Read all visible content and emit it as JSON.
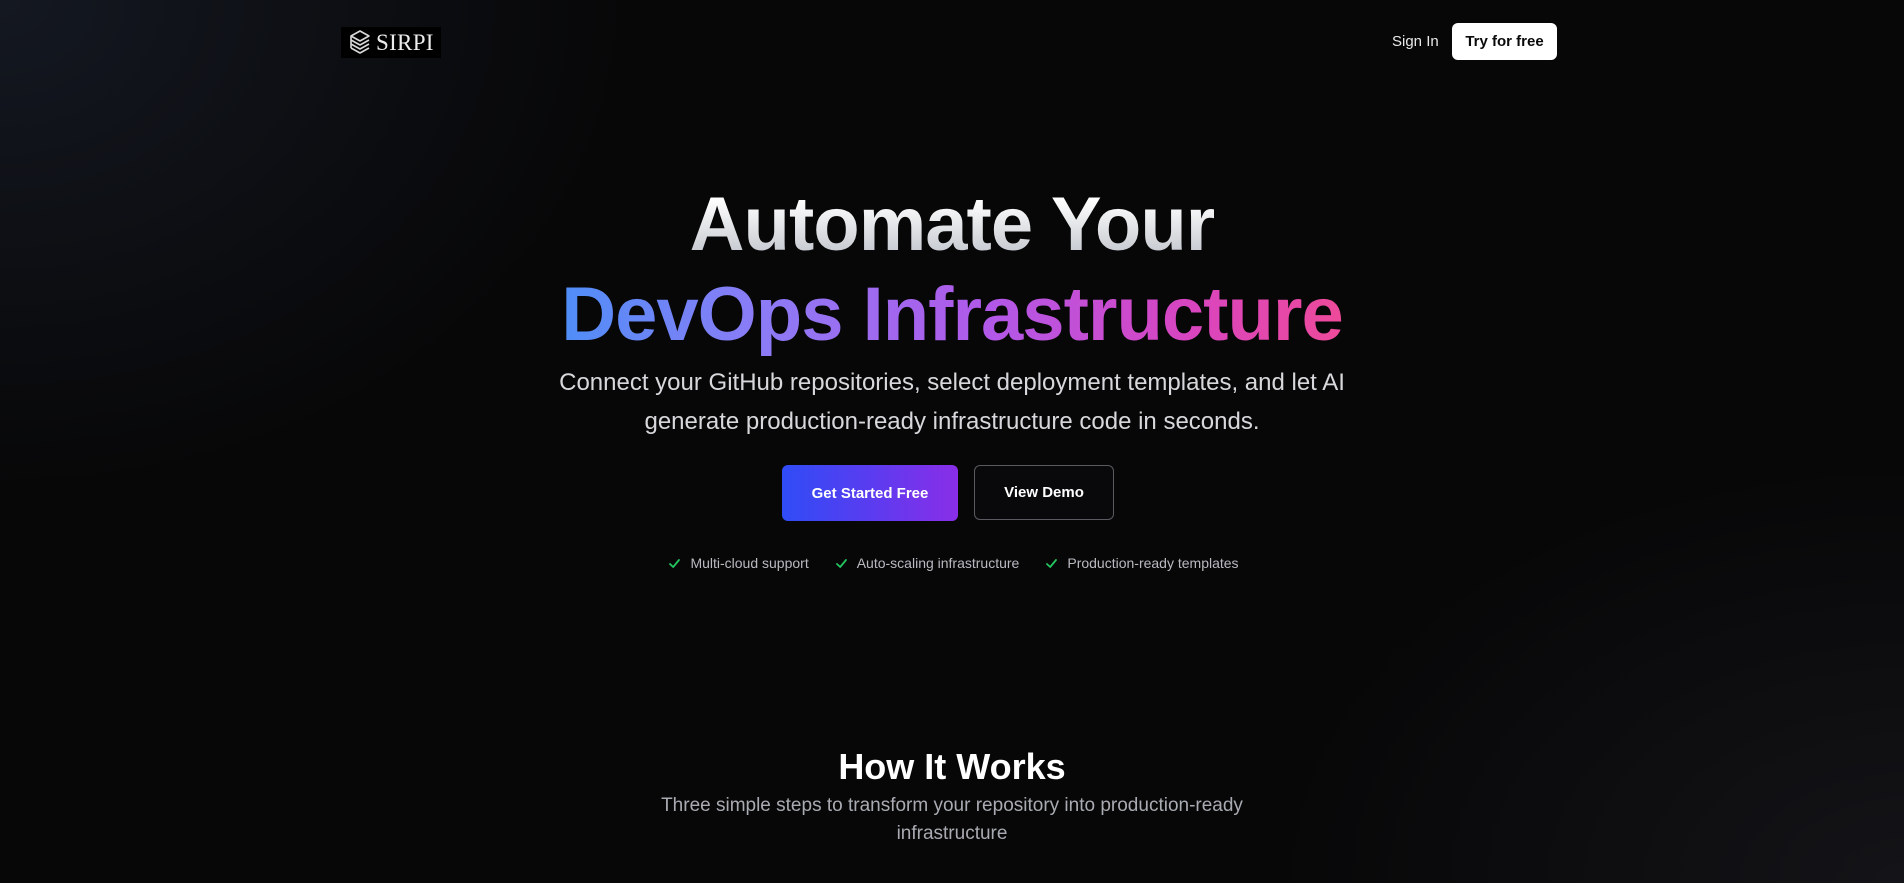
{
  "nav": {
    "logo_text": "SIRPI",
    "sign_in_label": "Sign In",
    "try_label": "Try for free"
  },
  "hero": {
    "title_line1": "Automate Your",
    "title_line2": "DevOps Infrastructure",
    "subtitle": "Connect your GitHub repositories, select deployment templates, and let AI generate production-ready infrastructure code in seconds.",
    "primary_cta": "Get Started Free",
    "secondary_cta": "View Demo",
    "features": [
      {
        "label": "Multi-cloud support",
        "icon": "check-icon"
      },
      {
        "label": "Auto-scaling infrastructure",
        "icon": "check-icon"
      },
      {
        "label": "Production-ready templates",
        "icon": "check-icon"
      }
    ]
  },
  "how_it_works": {
    "title": "How It Works",
    "subtitle": "Three simple steps to transform your repository into production-ready infrastructure"
  },
  "colors": {
    "background": "#070708",
    "primary_gradient_start": "#2f4cf6",
    "primary_gradient_end": "#8a2ee8",
    "headline_gradient_start": "#4f8ef7",
    "headline_gradient_end": "#ee4a9a",
    "check_green": "#22c55e"
  }
}
